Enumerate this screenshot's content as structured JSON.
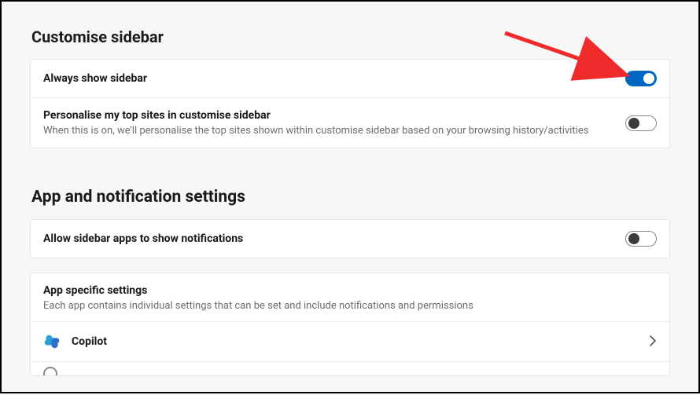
{
  "sections": {
    "customise": {
      "title": "Customise sidebar",
      "rows": {
        "always_show": {
          "label": "Always show sidebar",
          "enabled": true
        },
        "personalise": {
          "label": "Personalise my top sites in customise sidebar",
          "sub": "When this is on, we'll personalise the top sites shown within customise sidebar based on your browsing history/activities",
          "enabled": false
        }
      }
    },
    "notifications": {
      "title": "App and notification settings",
      "allow_notifications": {
        "label": "Allow sidebar apps to show notifications",
        "enabled": false
      },
      "app_specific": {
        "header": "App specific settings",
        "sub": "Each app contains individual settings that can be set and include notifications and permissions",
        "apps": {
          "copilot": {
            "name": "Copilot"
          }
        }
      }
    }
  }
}
